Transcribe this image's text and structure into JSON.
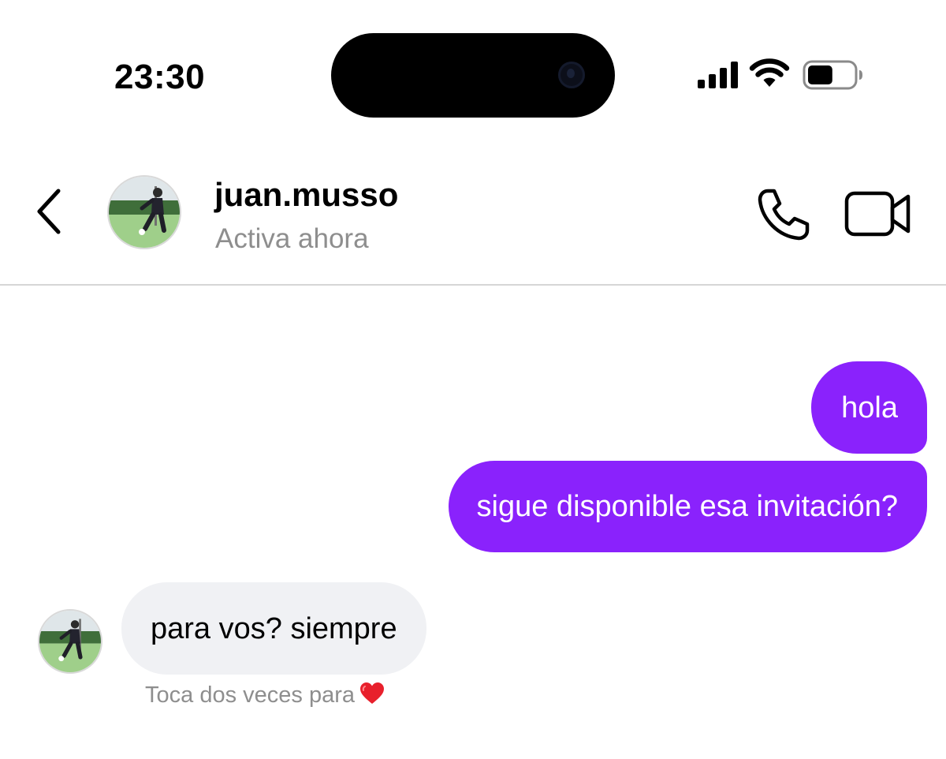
{
  "status_bar": {
    "time": "23:30",
    "icons": [
      "signal-icon",
      "wifi-icon",
      "battery-icon"
    ],
    "battery_level": 0.55
  },
  "header": {
    "username": "juan.musso",
    "presence": "Activa ahora",
    "icons": [
      "back-icon",
      "phone-icon",
      "video-camera-icon"
    ]
  },
  "messages": [
    {
      "direction": "outgoing",
      "text": "hola"
    },
    {
      "direction": "outgoing",
      "text": "sigue disponible esa invitación?"
    },
    {
      "direction": "incoming",
      "text": "para vos? siempre"
    }
  ],
  "reaction_hint": {
    "text": "Toca dos veces para",
    "icon": "heart-icon"
  },
  "colors": {
    "outgoing_bubble": "#8a22fc",
    "incoming_bubble": "#f0f1f4",
    "secondary_text": "#8e8e8e",
    "heart": "#e8202c"
  }
}
